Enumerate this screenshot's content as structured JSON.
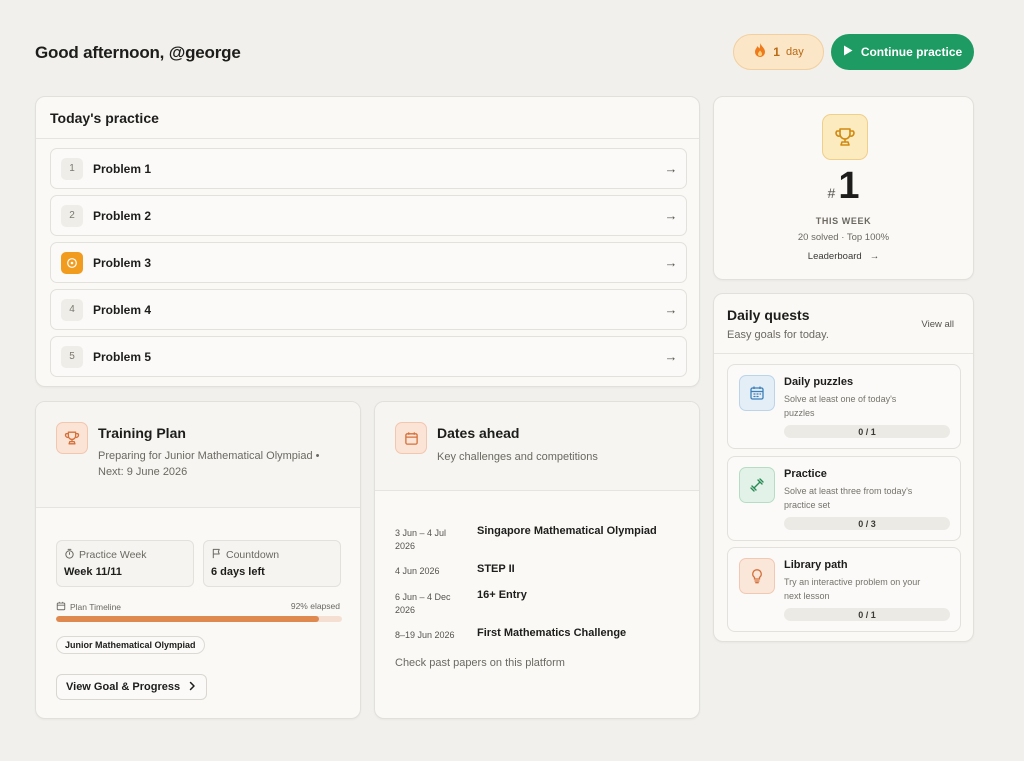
{
  "header": {
    "greeting": "Good afternoon, @george",
    "streak_value": "1",
    "streak_unit": "day",
    "continue_label": "Continue practice"
  },
  "todays_practice": {
    "title": "Today's practice",
    "problems": [
      {
        "index": "1",
        "label": "Problem 1",
        "active": false
      },
      {
        "index": "2",
        "label": "Problem 2",
        "active": false
      },
      {
        "index": "",
        "label": "Problem 3",
        "active": true
      },
      {
        "index": "4",
        "label": "Problem 4",
        "active": false
      },
      {
        "index": "5",
        "label": "Problem 5",
        "active": false
      }
    ]
  },
  "rank": {
    "hash": "#",
    "number": "1",
    "period": "THIS WEEK",
    "stats": "20 solved · Top 100%",
    "link": "Leaderboard"
  },
  "daily_quests": {
    "title": "Daily quests",
    "subtitle": "Easy goals for today.",
    "view_all": "View all",
    "items": [
      {
        "title": "Daily puzzles",
        "desc": "Solve at least one of today's puzzles",
        "progress": "0 / 1",
        "icon": "calendar-icon"
      },
      {
        "title": "Practice",
        "desc": "Solve at least three from today's practice set",
        "progress": "0 / 3",
        "icon": "dumbbell-icon"
      },
      {
        "title": "Library path",
        "desc": "Try an interactive problem on your next lesson",
        "progress": "0 / 1",
        "icon": "lightbulb-icon"
      }
    ]
  },
  "training_plan": {
    "title": "Training Plan",
    "subtitle": "Preparing for Junior Mathematical Olympiad • Next: 9 June 2026",
    "week_label": "Practice Week",
    "week_value": "Week 11/11",
    "countdown_label": "Countdown",
    "countdown_value": "6 days left",
    "timeline_label": "Plan Timeline",
    "elapsed_label": "92% elapsed",
    "elapsed_fraction": 0.92,
    "chip": "Junior Mathematical Olympiad",
    "button": "View Goal & Progress"
  },
  "dates_ahead": {
    "title": "Dates ahead",
    "subtitle": "Key challenges and competitions",
    "events": [
      {
        "date": "3 Jun – 4 Jul 2026",
        "name": "Singapore Mathematical Olympiad"
      },
      {
        "date": "4 Jun 2026",
        "name": "STEP II"
      },
      {
        "date": "6 Jun – 4 Dec 2026",
        "name": "16+ Entry"
      },
      {
        "date": "8–19 Jun 2026",
        "name": "First Mathematics Challenge"
      }
    ],
    "past_link": "Check past papers on this platform"
  },
  "colors": {
    "accent_green": "#1d9b63",
    "streak_orange": "#b86a14",
    "progress_orange": "#e0894e",
    "active_problem": "#f29c1f"
  }
}
